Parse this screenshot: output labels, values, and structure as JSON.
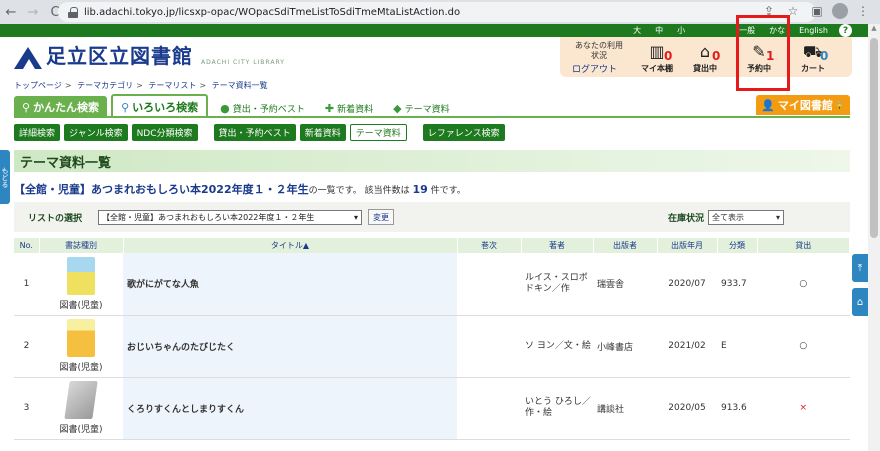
{
  "browser": {
    "url": "lib.adachi.tokyo.jp/licsxp-opac/WOpacSdiTmeListToSdiTmeMtaListAction.do",
    "back": "←",
    "forward": "→",
    "reload": "C"
  },
  "topbar": {
    "font_large": "大",
    "font_medium": "中",
    "font_small": "小",
    "mode_general": "一般",
    "mode_kana": "かな",
    "english": "English",
    "help": "?"
  },
  "logo": {
    "name": "足立区立図書館",
    "sub": "ADACHI CITY LIBRARY"
  },
  "status": {
    "label": "あなたの利用状況",
    "logout": "ログアウト",
    "items": [
      {
        "label": "マイ本棚",
        "count": "0",
        "icon": "bookshelf-icon"
      },
      {
        "label": "貸出中",
        "count": "0",
        "icon": "house-icon"
      },
      {
        "label": "予約中",
        "count": "1",
        "icon": "reserve-icon"
      },
      {
        "label": "カート",
        "count": "0",
        "icon": "cart-icon"
      }
    ]
  },
  "breadcrumb": [
    "トップページ",
    "テーマカテゴリ",
    "テーマリスト",
    "テーマ資料一覧"
  ],
  "tabs": {
    "easy": "かんたん検索",
    "various": "いろいろ検索",
    "best": "貸出・予約ベスト",
    "new": "新着資料",
    "theme": "テーマ資料",
    "mylib": "マイ図書館"
  },
  "subnav": [
    "詳細検索",
    "ジャンル検索",
    "NDC分類検索",
    "貸出・予約ベスト",
    "新着資料",
    "テーマ資料",
    "レファレンス検索"
  ],
  "side_tab": "もどる",
  "page_title": "テーマ資料一覧",
  "result": {
    "theme": "【全館・児童】あつまれおもしろい本2022年度１・２年生",
    "suffix": "の一覧です。 該当件数は",
    "count": "19",
    "unit": "件です。"
  },
  "list_select": {
    "label": "リストの選択",
    "value": "【全館・児童】あつまれおもしろい本2022年度１・２年生",
    "change_button": "変更",
    "stock_label": "在庫状況",
    "stock_value": "全て表示"
  },
  "table": {
    "headers": [
      "No.",
      "書誌種別",
      "タイトル▲",
      "巻次",
      "著者",
      "出版者",
      "出版年月",
      "分類",
      "貸出"
    ],
    "rows": [
      {
        "no": "1",
        "type": "図書(児童)",
        "title": "歌がにがてな人魚",
        "vol": "",
        "author": "ルイス・スロボドキン／作",
        "publisher": "瑞雲舎",
        "date": "2020/07",
        "class": "933.7",
        "avail": "○"
      },
      {
        "no": "2",
        "type": "図書(児童)",
        "title": "おじいちゃんのたびじたく",
        "vol": "",
        "author": "ソ ヨン／文・絵",
        "publisher": "小峰書店",
        "date": "2021/02",
        "class": "E",
        "avail": "○"
      },
      {
        "no": "3",
        "type": "図書(児童)",
        "title": "くろりすくんとしまりすくん",
        "vol": "",
        "author": "いとう ひろし／作・絵",
        "publisher": "講談社",
        "date": "2020/05",
        "class": "913.6",
        "avail": "×"
      }
    ]
  }
}
